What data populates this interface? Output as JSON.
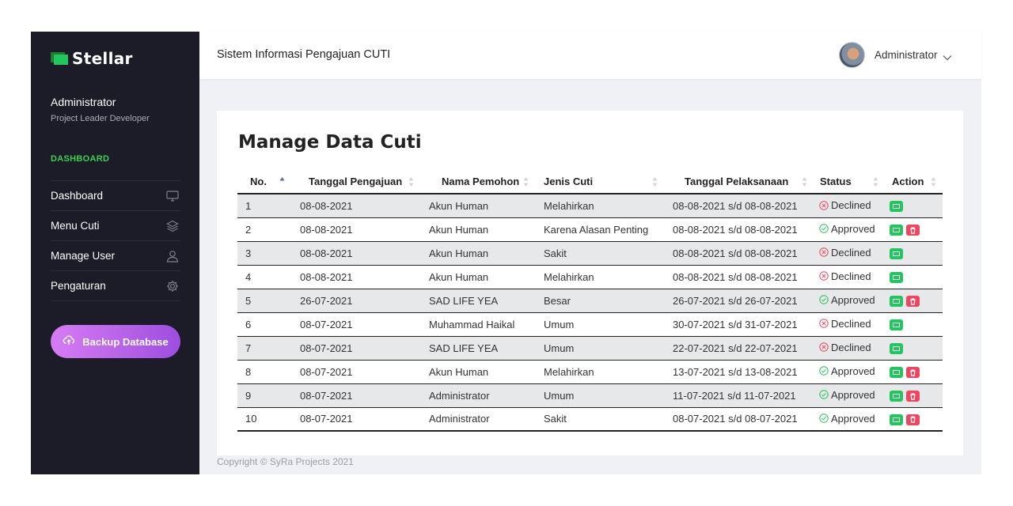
{
  "sidebar": {
    "brand": "Stellar",
    "profile_name": "Administrator",
    "profile_role": "Project Leader Developer",
    "section_title": "DASHBOARD",
    "items": [
      {
        "label": "Dashboard",
        "icon": "monitor-icon"
      },
      {
        "label": "Menu Cuti",
        "icon": "layers-icon"
      },
      {
        "label": "Manage User",
        "icon": "user-icon"
      },
      {
        "label": "Pengaturan",
        "icon": "gear-icon"
      }
    ],
    "backup_label": "Backup Database"
  },
  "header": {
    "title": "Sistem Informasi Pengajuan CUTI",
    "user": "Administrator"
  },
  "card": {
    "title": "Manage Data Cuti"
  },
  "table": {
    "headers": [
      "No.",
      "Tanggal Pengajuan",
      "Nama Pemohon",
      "Jenis Cuti",
      "Tanggal Pelaksanaan",
      "Status",
      "Action"
    ],
    "rows": [
      {
        "no": "1",
        "tgl": "08-08-2021",
        "nama": "Akun Human",
        "jenis": "Melahirkan",
        "pelaksanaan": "08-08-2021 s/d 08-08-2021",
        "status": "Declined"
      },
      {
        "no": "2",
        "tgl": "08-08-2021",
        "nama": "Akun Human",
        "jenis": "Karena Alasan Penting",
        "pelaksanaan": "08-08-2021 s/d 08-08-2021",
        "status": "Approved"
      },
      {
        "no": "3",
        "tgl": "08-08-2021",
        "nama": "Akun Human",
        "jenis": "Sakit",
        "pelaksanaan": "08-08-2021 s/d 08-08-2021",
        "status": "Declined"
      },
      {
        "no": "4",
        "tgl": "08-08-2021",
        "nama": "Akun Human",
        "jenis": "Melahirkan",
        "pelaksanaan": "08-08-2021 s/d 08-08-2021",
        "status": "Declined"
      },
      {
        "no": "5",
        "tgl": "26-07-2021",
        "nama": "SAD LIFE YEA",
        "jenis": "Besar",
        "pelaksanaan": "26-07-2021 s/d 26-07-2021",
        "status": "Approved"
      },
      {
        "no": "6",
        "tgl": "08-07-2021",
        "nama": "Muhammad Haikal",
        "jenis": "Umum",
        "pelaksanaan": "30-07-2021 s/d 31-07-2021",
        "status": "Declined"
      },
      {
        "no": "7",
        "tgl": "08-07-2021",
        "nama": "SAD LIFE YEA",
        "jenis": "Umum",
        "pelaksanaan": "22-07-2021 s/d 22-07-2021",
        "status": "Declined"
      },
      {
        "no": "8",
        "tgl": "08-07-2021",
        "nama": "Akun Human",
        "jenis": "Melahirkan",
        "pelaksanaan": "13-07-2021 s/d 13-08-2021",
        "status": "Approved"
      },
      {
        "no": "9",
        "tgl": "08-07-2021",
        "nama": "Administrator",
        "jenis": "Umum",
        "pelaksanaan": "11-07-2021 s/d 11-07-2021",
        "status": "Approved"
      },
      {
        "no": "10",
        "tgl": "08-07-2021",
        "nama": "Administrator",
        "jenis": "Sakit",
        "pelaksanaan": "08-07-2021 s/d 08-07-2021",
        "status": "Approved"
      }
    ]
  },
  "footer": {
    "copyright": "Copyright © SyRa Projects 2021"
  },
  "colors": {
    "sidebar_bg": "#1c1c28",
    "accent_green": "#22c55e",
    "declined_red": "#f0455f",
    "backup_gradient_start": "#d77cf3",
    "backup_gradient_end": "#9d4ee0"
  }
}
